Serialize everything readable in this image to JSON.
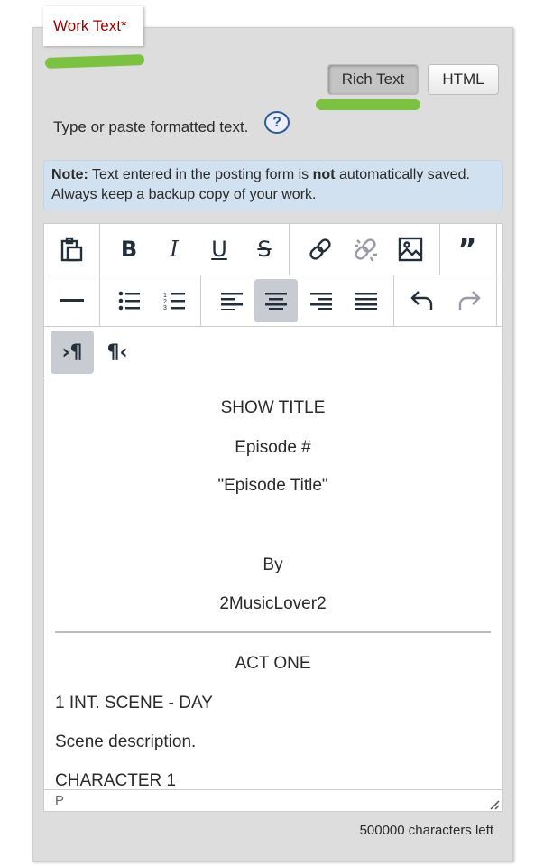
{
  "legend": "Work Text*",
  "mode_buttons": {
    "rich": "Rich Text",
    "html": "HTML",
    "active": "rich"
  },
  "hint": "Type or paste formatted text.",
  "help_icon": "?",
  "note": {
    "label": "Note:",
    "text1": " Text entered in the posting form is ",
    "bold": "not",
    "text2": " automatically saved. Always keep a backup copy of your work."
  },
  "toolbar": {
    "row1": [
      "paste",
      "bold",
      "italic",
      "underline",
      "strikethrough",
      "link",
      "unlink",
      "image",
      "blockquote"
    ],
    "row2": [
      "horizontal-rule",
      "bullet-list",
      "numbered-list",
      "align-left",
      "align-center",
      "align-right",
      "justify",
      "undo",
      "redo"
    ],
    "row3": [
      "ltr",
      "rtl"
    ],
    "active": [
      "align-center",
      "ltr"
    ],
    "disabled": [
      "unlink",
      "redo"
    ]
  },
  "content": {
    "title": "SHOW TITLE",
    "episode": "Episode #",
    "episode_title": "\"Episode Title\"",
    "by": "By",
    "author": "2MusicLover2",
    "act": "ACT ONE",
    "scene": "1  INT. SCENE - DAY",
    "description": "Scene description.",
    "character": "CHARACTER 1"
  },
  "status_path": "P",
  "chars_left": "500000 characters left",
  "highlight_color": "#7cc242"
}
